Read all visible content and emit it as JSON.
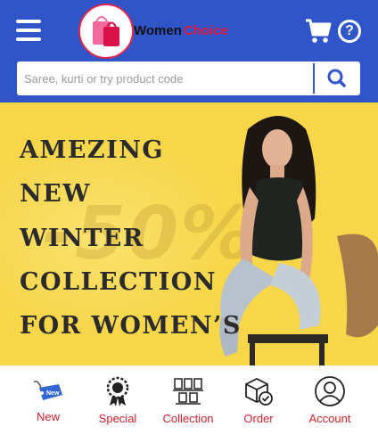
{
  "header": {
    "brand_word1": "Women",
    "brand_word2": "Choice",
    "icons": [
      "menu-icon",
      "bag-logo-icon",
      "cart-icon",
      "help-icon"
    ],
    "help_glyph": "?"
  },
  "search": {
    "placeholder": "Saree, kurti or try product code",
    "value": "",
    "icon": "search-icon"
  },
  "banner": {
    "lines": [
      "AMEZING",
      "NEW",
      "WINTER",
      "COLLECTION",
      "FOR WOMEN’S"
    ],
    "discount": "-50%"
  },
  "bottom_nav": [
    {
      "label": "New",
      "icon": "new-tag-icon"
    },
    {
      "label": "Special",
      "icon": "award-badge-icon"
    },
    {
      "label": "Collection",
      "icon": "books-shelf-icon"
    },
    {
      "label": "Order",
      "icon": "package-check-icon"
    },
    {
      "label": "Account",
      "icon": "user-icon"
    }
  ],
  "colors": {
    "header_bg": "#2f55c8",
    "banner_bg": "#f7d64a",
    "nav_label": "#d21f2b",
    "brand_red": "#e3183f"
  }
}
